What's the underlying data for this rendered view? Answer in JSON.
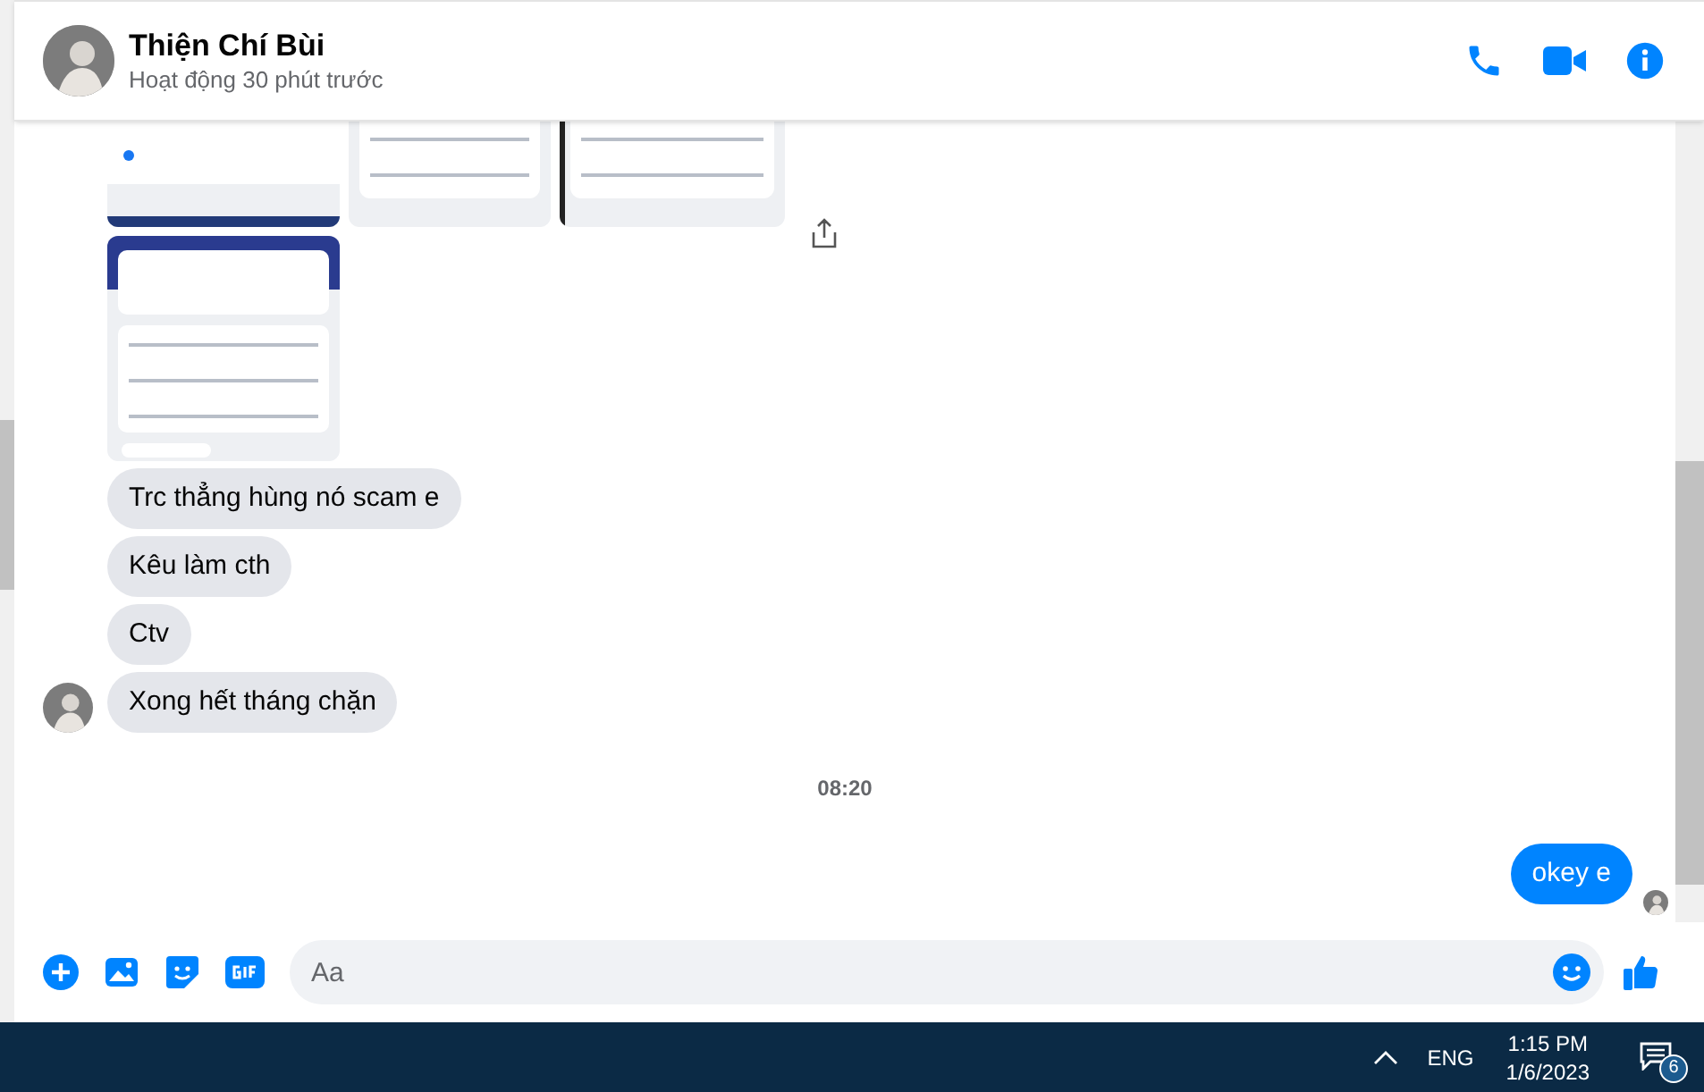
{
  "header": {
    "name": "Thiện Chí Bùi",
    "status": "Hoạt động 30 phút trước"
  },
  "messages": [
    {
      "kind": "images"
    },
    {
      "kind": "images"
    },
    {
      "kind": "incoming",
      "text": "Trc thẳng hùng nó scam e",
      "avatar": false
    },
    {
      "kind": "incoming",
      "text": "Kêu làm cth",
      "avatar": false
    },
    {
      "kind": "incoming",
      "text": "Ctv",
      "avatar": false
    },
    {
      "kind": "incoming",
      "text": "Xong hết tháng chặn",
      "avatar": true
    },
    {
      "kind": "time",
      "text": "08:20"
    },
    {
      "kind": "outgoing",
      "text": "okey e",
      "seen": true
    }
  ],
  "composer": {
    "placeholder": "Aa"
  },
  "taskbar": {
    "language": "ENG",
    "time": "1:15 PM",
    "date": "1/6/2023",
    "notifications": "6"
  }
}
